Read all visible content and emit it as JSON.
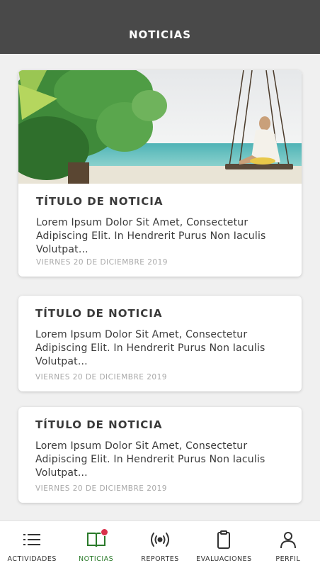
{
  "header": {
    "title": "NOTICIAS"
  },
  "news": [
    {
      "title": "TÍTULO DE NOTICIA",
      "text": "Lorem Ipsum Dolor Sit Amet, Consectetur Adipiscing Elit. In Hendrerit Purus Non Iaculis Volutpat...",
      "date": "VIERNES 20 DE DICIEMBRE 2019",
      "image": "beach-swing-photo"
    },
    {
      "title": "TÍTULO DE NOTICIA",
      "text": "Lorem Ipsum Dolor Sit Amet, Consectetur Adipiscing Elit. In Hendrerit Purus Non Iaculis Volutpat...",
      "date": "VIERNES 20 DE DICIEMBRE 2019"
    },
    {
      "title": "TÍTULO DE NOTICIA",
      "text": "Lorem Ipsum Dolor Sit Amet, Consectetur Adipiscing Elit. In Hendrerit Purus Non Iaculis Volutpat...",
      "date": "VIERNES 20 DE DICIEMBRE 2019"
    }
  ],
  "nav": [
    {
      "label": "ACTIVIDADES",
      "icon": "list-icon",
      "active": false
    },
    {
      "label": "NOTICIAS",
      "icon": "book-icon",
      "active": true,
      "badge": true
    },
    {
      "label": "REPORTES",
      "icon": "broadcast-icon",
      "active": false
    },
    {
      "label": "EVALUACIONES",
      "icon": "clipboard-icon",
      "active": false
    },
    {
      "label": "PERFIL",
      "icon": "user-icon",
      "active": false
    }
  ],
  "colors": {
    "header_bg": "#494949",
    "active": "#2a7a2a",
    "badge": "#d9304a"
  }
}
